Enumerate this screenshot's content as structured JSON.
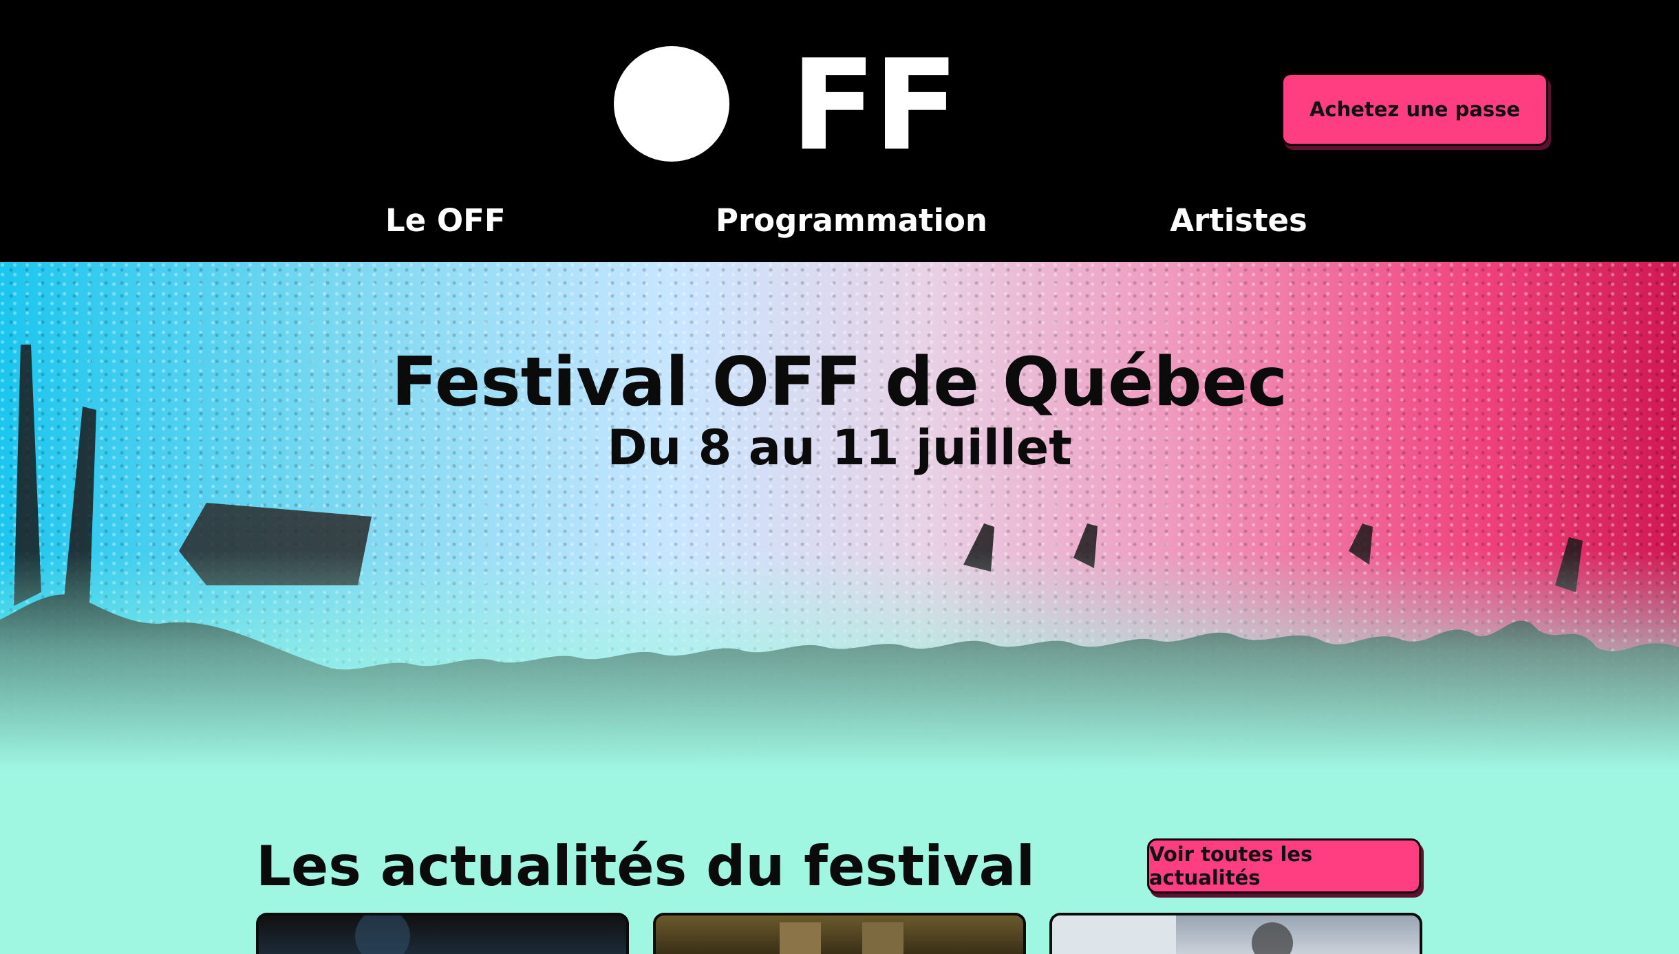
{
  "header": {
    "logo_text": "FF",
    "buy_button": "Achetez une passe",
    "nav": [
      {
        "label": "Le OFF"
      },
      {
        "label": "Programmation"
      },
      {
        "label": "Artistes"
      }
    ]
  },
  "hero": {
    "title": "Festival OFF de Québec",
    "dates": "Du 8 au 11 juillet"
  },
  "news": {
    "title": "Les actualités du festival",
    "see_all_button": "Voir toutes les actualités"
  },
  "colors": {
    "accent": "#ff3e82",
    "header_bg": "#000000",
    "page_bg": "#9ff7e2"
  }
}
